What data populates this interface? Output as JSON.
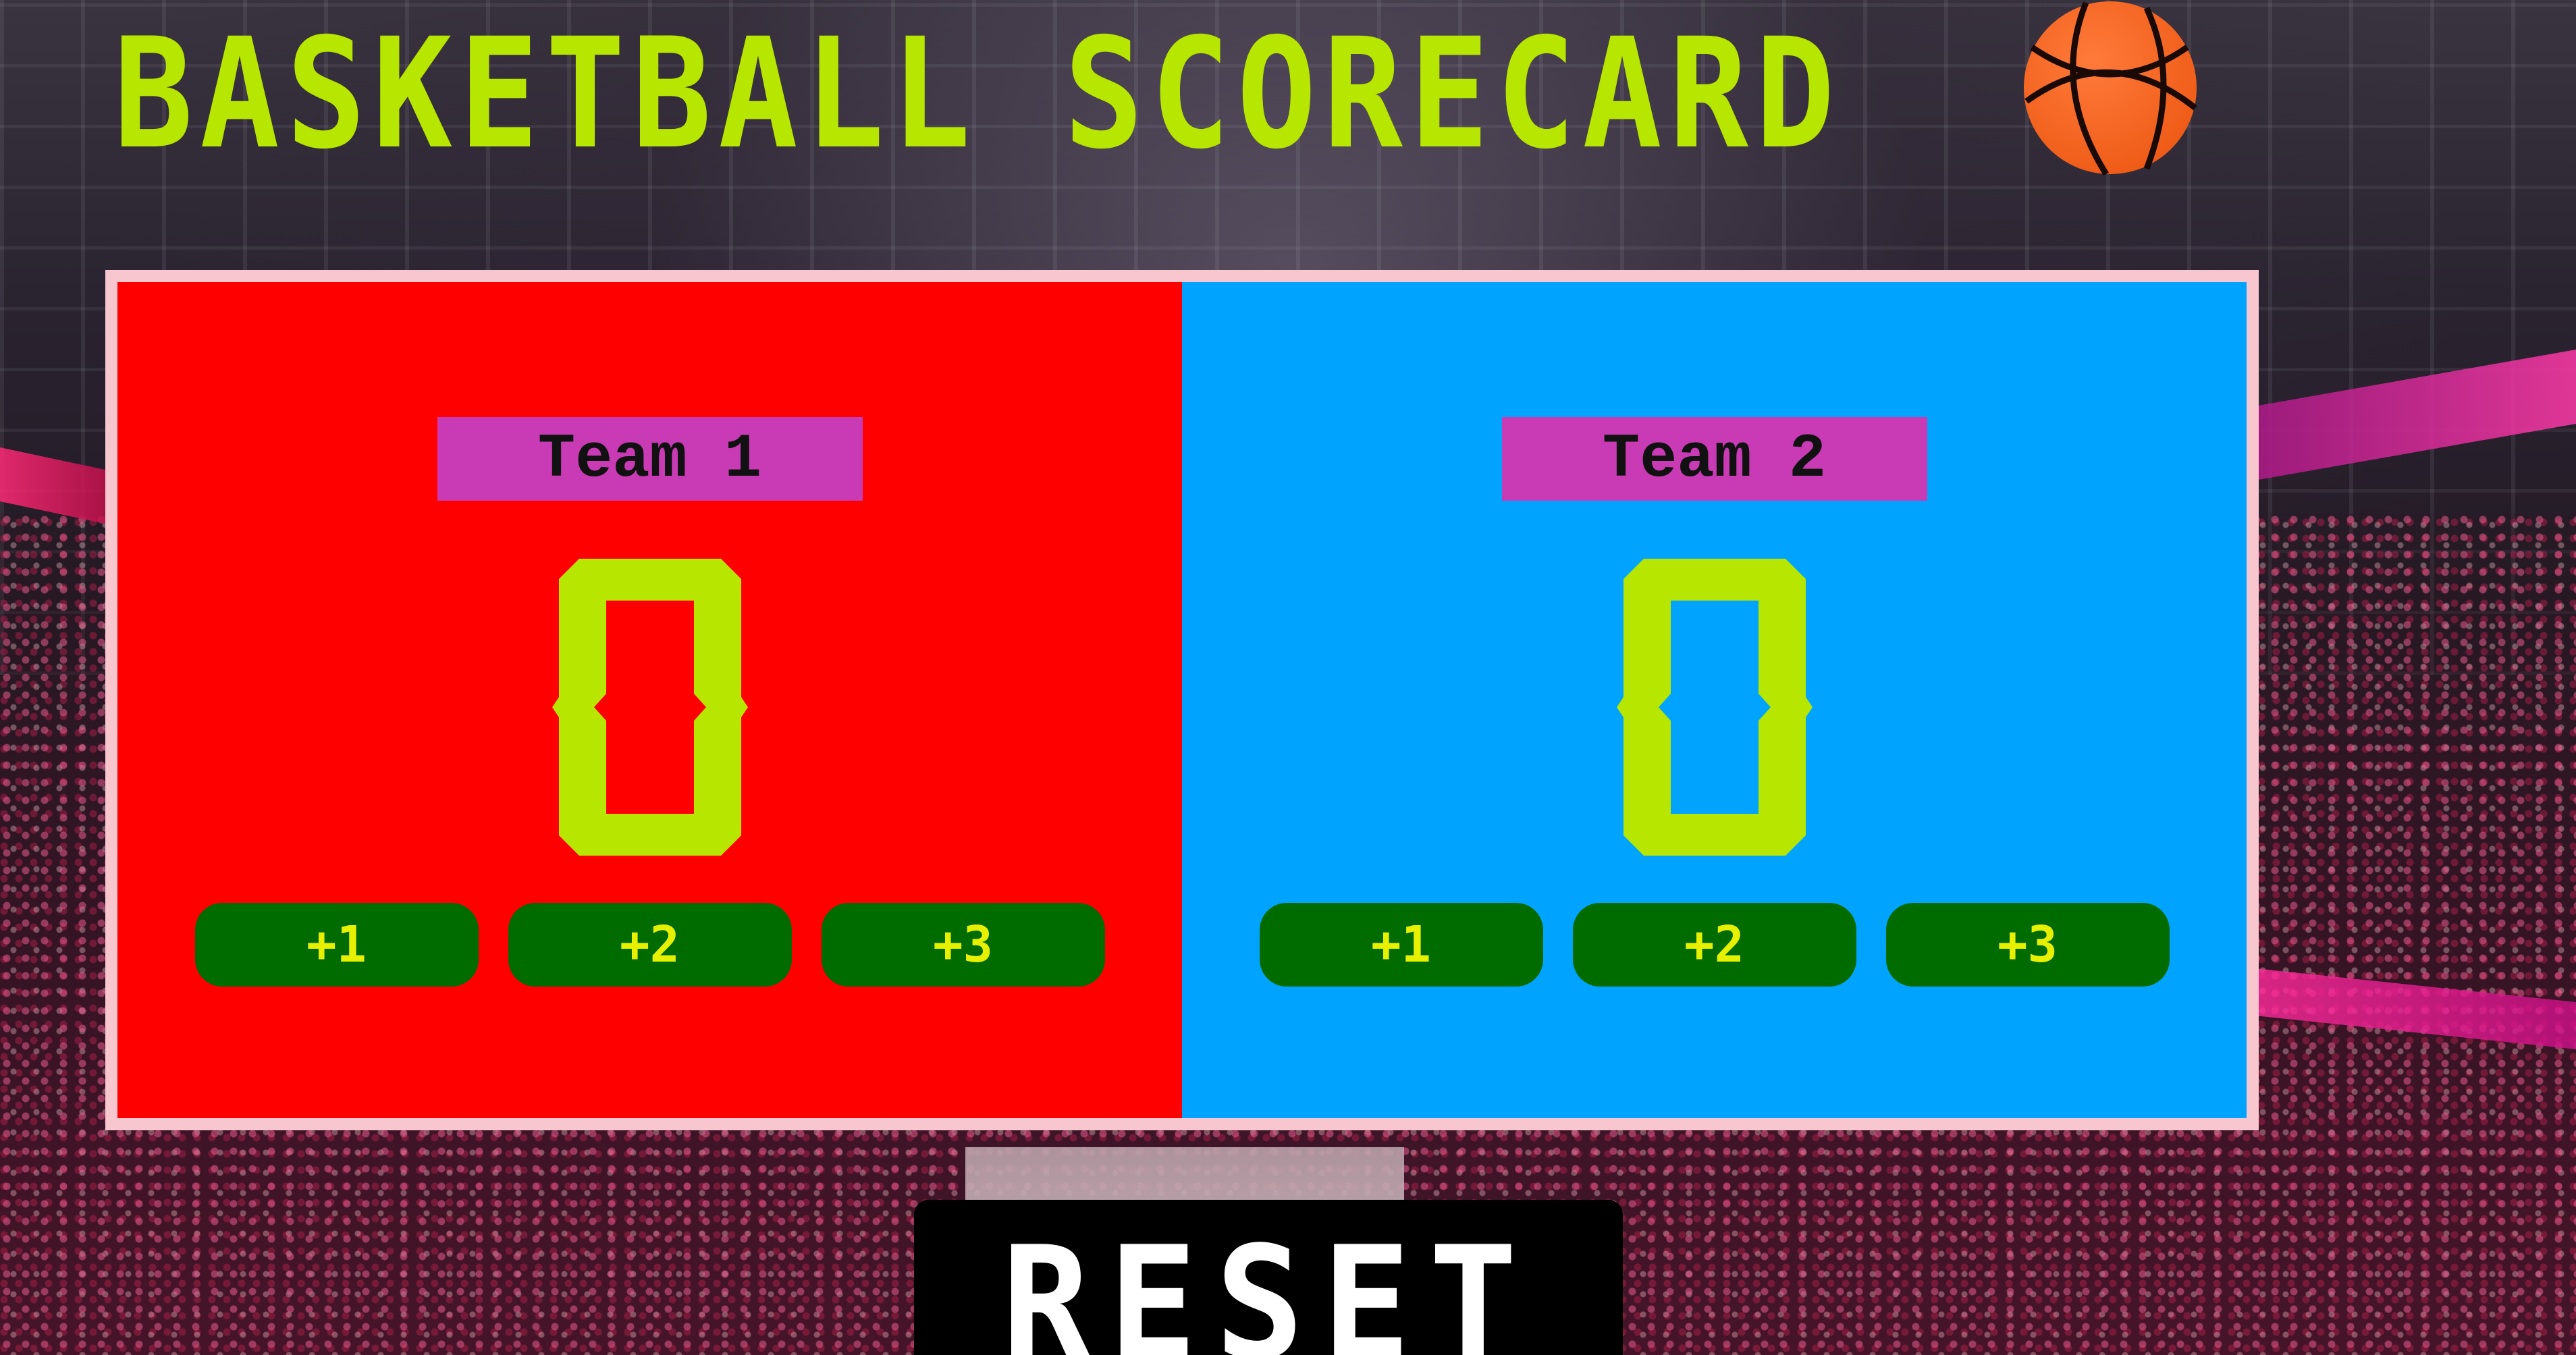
{
  "app": {
    "title": "BASKETBALL SCORECARD",
    "title_icon": "basketball-icon"
  },
  "colors": {
    "title": "#b7e600",
    "home_panel": "#ff0000",
    "guest_panel": "#00a4ff",
    "board_border": "#f7c6cf",
    "team_label_bg": "#c93ab5",
    "score_digit": "#b7e600",
    "point_button_bg": "#006c00",
    "point_button_text": "#e6f000",
    "reset_bg": "#000000",
    "reset_text": "#ffffff"
  },
  "teams": [
    {
      "name": "Team 1",
      "score": 0,
      "buttons": [
        "+1",
        "+2",
        "+3"
      ]
    },
    {
      "name": "Team 2",
      "score": 0,
      "buttons": [
        "+1",
        "+2",
        "+3"
      ]
    }
  ],
  "reset": {
    "label": "RESET"
  }
}
